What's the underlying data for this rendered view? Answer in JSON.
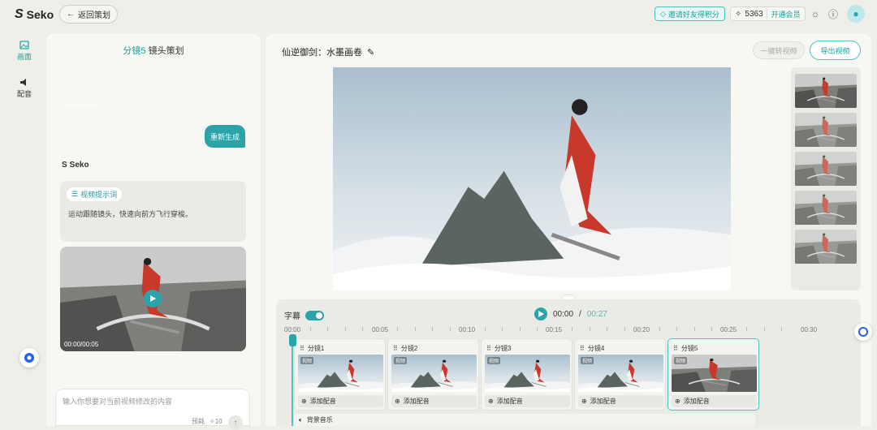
{
  "app": {
    "logo_text": "Seko"
  },
  "topbar": {
    "back_label": "返回策划",
    "invite_label": "邀请好友得积分",
    "credits": "5363",
    "vip_label": "开通会员",
    "icons": [
      "sun-icon",
      "help-icon",
      "avatar-icon"
    ]
  },
  "rail": {
    "items": [
      {
        "label": "画面",
        "icon": "image-icon",
        "active": true
      },
      {
        "label": "配音",
        "icon": "speaker-icon",
        "active": false
      }
    ]
  },
  "left_panel": {
    "title_accent": "分镜5",
    "title_rest": "镜头策划",
    "video1_time": "00:00/00:05",
    "regen_label": "重新生成",
    "assistant_name": "Seko",
    "prompt_chip": "视频提示词",
    "prompt_text": "运动跟随镜头，快速向前方飞行穿梭。",
    "video2_time": "00:00/00:05",
    "input_placeholder": "输入你想要对当前视频修改的内容",
    "input_model": "预耗",
    "input_cost": "10"
  },
  "main": {
    "project_title": "仙逆御剑：水墨画卷",
    "convert_label": "一键转视频",
    "export_label": "导出视频",
    "side_thumb_count": 5
  },
  "timeline": {
    "subtitle_label": "字幕",
    "current_time": "00:00",
    "separator": "/",
    "duration": "00:27",
    "ruler_labels": [
      "00:00",
      "00:05",
      "00:10",
      "00:15",
      "00:20",
      "00:25",
      "00:30"
    ],
    "clips": [
      {
        "title": "分镜1",
        "badge": "视频",
        "audio": "添加配音",
        "selected": false
      },
      {
        "title": "分镜2",
        "badge": "视频",
        "audio": "添加配音",
        "selected": false
      },
      {
        "title": "分镜3",
        "badge": "视频",
        "audio": "添加配音",
        "selected": false
      },
      {
        "title": "分镜4",
        "badge": "视频",
        "audio": "添加配音",
        "selected": false
      },
      {
        "title": "分镜5",
        "badge": "视频",
        "audio": "添加配音",
        "selected": true
      }
    ],
    "music_label": "背景音乐"
  },
  "colors": {
    "accent": "#2aa3a9",
    "robe": "#c8392b"
  }
}
